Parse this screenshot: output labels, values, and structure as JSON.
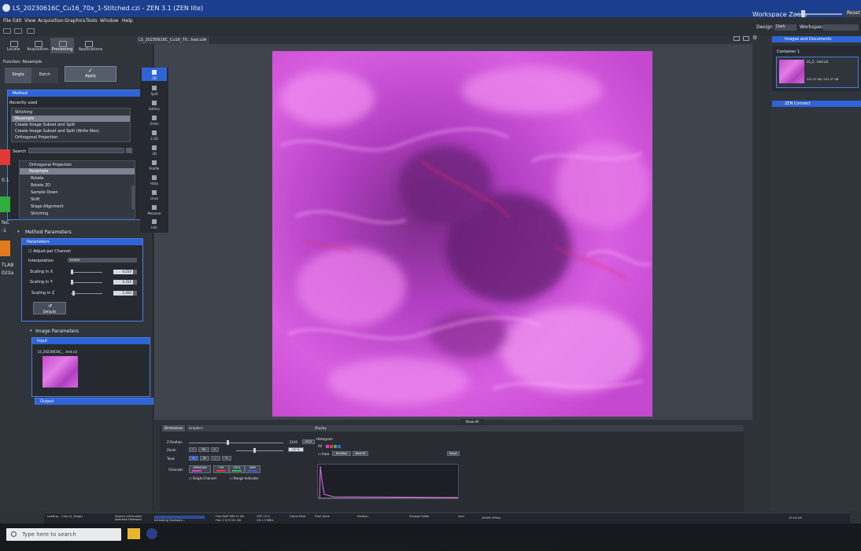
{
  "window": {
    "title": "LS_20230616C_Cu16_70x_1-Stitched.czi - ZEN 3.1 (ZEN lite)",
    "workspace_zoom_label": "Workspace Zoom",
    "workspace_zoom_reset": "Reset",
    "design_label": "Design",
    "design_value": "Dark",
    "workspace_label": "Workspace"
  },
  "menu": [
    "File",
    "Edit",
    "View",
    "Acquisition",
    "Graphics",
    "Tools",
    "Window",
    "Help"
  ],
  "left_tabs": [
    "Locate",
    "Acquisition",
    "Processing",
    "Applications"
  ],
  "function": {
    "label": "Function: Resample",
    "single": "Single",
    "batch": "Batch",
    "apply": "Apply"
  },
  "method": {
    "header": "Method",
    "recently_used_label": "Recently used",
    "recently_used": [
      "Stitching",
      "Resample",
      "Create Image Subset and Split",
      "Create Image Subset and Split (Write files)",
      "Orthogonal Projection"
    ],
    "search_label": "Search",
    "list": [
      "Orthogonal Projection",
      "Resample",
      "Rotate",
      "Rotate 2D",
      "Sample Down",
      "Shift",
      "Stage Alignment",
      "Stitching"
    ]
  },
  "method_parameters": {
    "title": "Method Parameters",
    "header": "Parameters",
    "adjust_per_channel": "Adjust per Channel",
    "interpolation_label": "Interpolation",
    "interpolation_value": "Linear",
    "scaling_x_label": "Scaling in X",
    "scaling_x_value": "0.250",
    "scaling_y_label": "Scaling in Y",
    "scaling_y_value": "0.250",
    "scaling_z_label": "Scaling in Z",
    "scaling_z_value": "1.000",
    "defaults": "Defaults"
  },
  "image_parameters": {
    "title": "Image Parameters",
    "input_header": "Input",
    "input_file": "LS_20230616C_...hed.czi",
    "output_header": "Output"
  },
  "document_tab": "LS_20230616C_Cu16_70...hed.czi",
  "view_tools": [
    "2D",
    "Split",
    "Gallery",
    "Ortho",
    "2.5D",
    "3D",
    "Profile",
    "Histo",
    "Lines",
    "Measure",
    "Info"
  ],
  "show_all": "Show All",
  "dimensions": {
    "tabs": [
      "Dimensions",
      "Graphics"
    ],
    "display_tab": "Display",
    "z_position_label": "Z-Position",
    "z_position_value": "2142",
    "z_position_max": "4072",
    "zoom_label": "Zoom",
    "zoom_value": "22 %",
    "fit_label": "Fit",
    "tools_label": "Tools",
    "channels_label": "Channels",
    "channels": [
      {
        "name": "WPASVAN",
        "color": "#d640d8"
      },
      {
        "name": "TxR",
        "color": "#e43a3a"
      },
      {
        "name": "CD31",
        "color": "#2fbf4a"
      },
      {
        "name": "DAPI",
        "color": "#3a5fe8"
      }
    ],
    "single_channel": "Single Channel",
    "range_indicator": "Range Indicator"
  },
  "display": {
    "histogram_label": "Histogram",
    "all": "All",
    "auto": "Auto",
    "min_max": "Min/Max",
    "best_fit": "Best Fit",
    "reset": "Reset"
  },
  "right_panel": {
    "images_header": "Images and Documents",
    "container": "Container 1",
    "file": "LS_2...hed.czi",
    "size": "221.37 GB / 221.37 GB",
    "zen_connect": "ZEN Connect"
  },
  "status": {
    "loading": "Loading... Chip (X, Stage)",
    "system_info": "System Information Available Hardware",
    "initializing": "Initializing Hardware...",
    "free_ram": "Free RAM 989.74 GB",
    "free_gb": "Free 1 D 57.81 GB",
    "cpu": "CPU 13 %",
    "cpu2": "CD 1.3 MB/s",
    "frame_rate": "Frame Rate",
    "pixel_value": "Pixel Value",
    "position": "Position",
    "storage": "Storage Folder",
    "user": "User",
    "apeer": "APEER Offline",
    "time": "10:16 AM"
  },
  "taskbar": {
    "search_placeholder": "Type here to search"
  },
  "desktop": [
    "0.1",
    "feC",
    "-1",
    "TLAB",
    "023a"
  ]
}
